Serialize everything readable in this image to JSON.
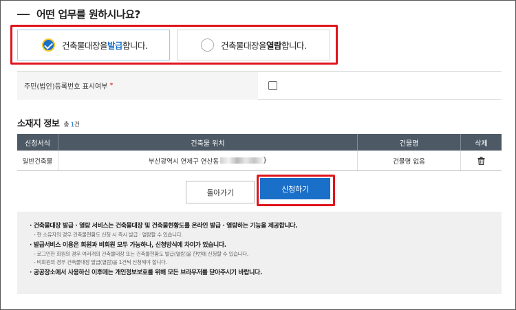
{
  "heading": "어떤 업무를 원하시나요?",
  "options": {
    "issue": {
      "pre": "건축물대장을 ",
      "hl": "발급",
      "post": "합니다.",
      "selected": true
    },
    "view": {
      "pre": "건축물대장을 ",
      "hl": "열람",
      "post": "합니다.",
      "selected": false
    }
  },
  "reg_number": {
    "label": "주민(법인)등록번호 표시여부",
    "required_mark": "*",
    "checked": false
  },
  "location": {
    "title": "소재지 정보",
    "count_prefix": "총 ",
    "count": "1",
    "count_suffix": "건",
    "columns": [
      "신청서식",
      "건축물 위치",
      "건물명",
      "삭제"
    ],
    "rows": [
      {
        "form": "일반건축물",
        "address": "부산광역시 연제구 연산동",
        "address_tail": "}",
        "building": "건물명 없음"
      }
    ]
  },
  "buttons": {
    "back": "돌아가기",
    "apply": "신청하기"
  },
  "notice": {
    "line1": "· 건축물대장 발급 · 열람 서비스는 건축물대장 및 건축물현황도를 온라인 발급 · 열람하는 기능을 제공합니다.",
    "line1_sub": "- 현 소유자의 경우 건축물현황도 신청 시 즉시 발급 · 열람할 수 있습니다.",
    "line2": "· 발급서비스 이용은 회원과 비회원 모두 가능하나, 신청방식에 차이가 있습니다.",
    "line2_sub1": "- 로그인한 회원의 경우 여러개의 건축물대장 또는 건축물현황도 발급(열람)을 한번에 신청할 수 있습니다.",
    "line2_sub2": "- 비회원의 경우 건축물대장 발급(열람)을 1건씩 신청해야 합니다.",
    "line3": "· 공공장소에서 사용하신 이후에는 개인정보보호를 위해 모든 브라우저를 닫아주시기 바랍니다."
  },
  "colors": {
    "accent": "#1a6fc8",
    "highlight_border": "#e0141b",
    "table_header": "#4d5a66"
  }
}
